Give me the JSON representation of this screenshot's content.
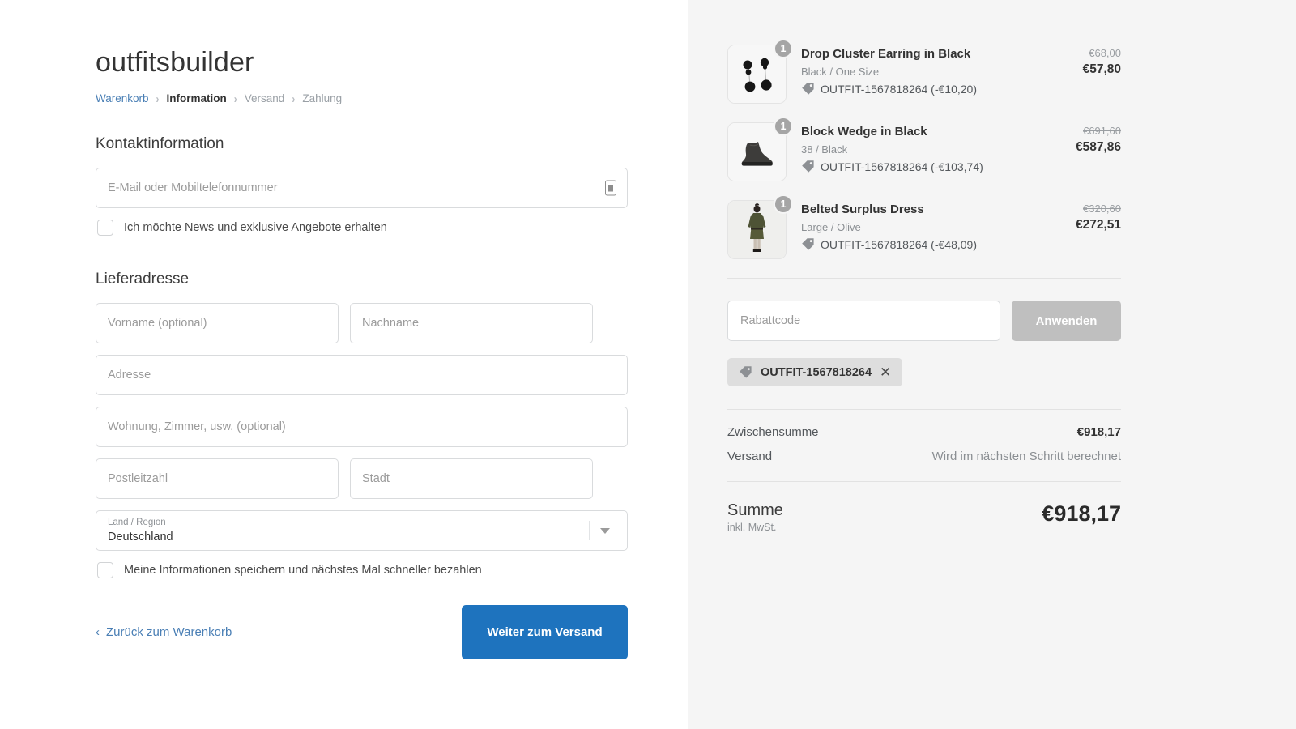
{
  "brand": "outfitsbuilder",
  "breadcrumb": [
    {
      "label": "Warenkorb",
      "state": "link"
    },
    {
      "label": "Information",
      "state": "current"
    },
    {
      "label": "Versand",
      "state": "muted"
    },
    {
      "label": "Zahlung",
      "state": "muted"
    }
  ],
  "breadcrumb_separator": "›",
  "contact": {
    "heading": "Kontaktinformation",
    "email_placeholder": "E-Mail oder Mobiltelefonnummer",
    "email_value": "",
    "newsletter_label": "Ich möchte News und exklusive Angebote erhalten",
    "newsletter_checked": false
  },
  "shipping": {
    "heading": "Lieferadresse",
    "first_name_placeholder": "Vorname (optional)",
    "last_name_placeholder": "Nachname",
    "address_placeholder": "Adresse",
    "address2_placeholder": "Wohnung, Zimmer, usw. (optional)",
    "zip_placeholder": "Postleitzahl",
    "city_placeholder": "Stadt",
    "country_label": "Land / Region",
    "country_value": "Deutschland",
    "save_info_label": "Meine Informationen speichern und nächstes Mal schneller bezahlen",
    "save_info_checked": false
  },
  "actions": {
    "back_chevron": "‹",
    "back_label": "Zurück zum Warenkorb",
    "continue_label": "Weiter zum Versand"
  },
  "summary": {
    "items": [
      {
        "name": "Drop Cluster Earring in Black",
        "variant": "Black / One Size",
        "qty": "1",
        "discount_text": "OUTFIT-1567818264 (-€10,20)",
        "price_original": "€68,00",
        "price_final": "€57,80",
        "thumb": "earring"
      },
      {
        "name": "Block Wedge in Black",
        "variant": "38 / Black",
        "qty": "1",
        "discount_text": "OUTFIT-1567818264 (-€103,74)",
        "price_original": "€691,60",
        "price_final": "€587,86",
        "thumb": "boot"
      },
      {
        "name": "Belted Surplus Dress",
        "variant": "Large / Olive",
        "qty": "1",
        "discount_text": "OUTFIT-1567818264 (-€48,09)",
        "price_original": "€320,60",
        "price_final": "€272,51",
        "thumb": "dress"
      }
    ],
    "promo_placeholder": "Rabattcode",
    "promo_value": "",
    "apply_label": "Anwenden",
    "applied_code": "OUTFIT-1567818264",
    "applied_code_remove": "✕",
    "subtotal_label": "Zwischensumme",
    "subtotal_value": "€918,17",
    "shipping_label": "Versand",
    "shipping_value": "Wird im nächsten Schritt berechnet",
    "total_label": "Summe",
    "total_note": "inkl. MwSt.",
    "total_value": "€918,17"
  }
}
